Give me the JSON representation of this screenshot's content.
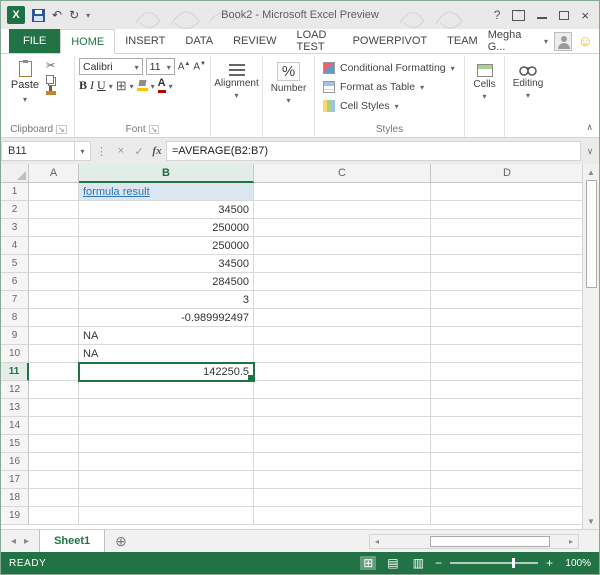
{
  "titlebar": {
    "title": "Book2 - Microsoft Excel Preview"
  },
  "tabs_row": {
    "tabs": [
      {
        "id": "file",
        "label": "FILE"
      },
      {
        "id": "home",
        "label": "HOME"
      },
      {
        "id": "insert",
        "label": "INSERT"
      },
      {
        "id": "data",
        "label": "DATA"
      },
      {
        "id": "review",
        "label": "REVIEW"
      },
      {
        "id": "load-test",
        "label": "LOAD TEST"
      },
      {
        "id": "powerpivot",
        "label": "POWERPIVOT"
      },
      {
        "id": "team",
        "label": "TEAM"
      }
    ],
    "active_tab": "HOME",
    "user_name": "Megha G..."
  },
  "ribbon": {
    "paste_label": "Paste",
    "font_name": "Calibri",
    "font_size": "11",
    "bold": "B",
    "italic": "I",
    "underline": "U",
    "percent": "%",
    "alignment_label": "Alignment",
    "number_label": "Number",
    "styles_buttons": [
      "Conditional Formatting",
      "Format as Table",
      "Cell Styles"
    ],
    "cells_label": "Cells",
    "editing_label": "Editing",
    "group_labels": {
      "clipboard": "Clipboard",
      "font": "Font",
      "styles": "Styles"
    }
  },
  "formula_bar": {
    "name_box": "B11",
    "fx_label": "fx",
    "formula": "=AVERAGE(B2:B7)"
  },
  "grid": {
    "columns": [
      "A",
      "B",
      "C",
      "D"
    ],
    "row_count": 19,
    "selected_cell": "B11",
    "selected_column": "B",
    "selected_row": 11,
    "cells": {
      "B1": {
        "text": "formula result",
        "align": "left",
        "style": "link"
      },
      "B2": {
        "text": "34500",
        "align": "right"
      },
      "B3": {
        "text": "250000",
        "align": "right"
      },
      "B4": {
        "text": "250000",
        "align": "right"
      },
      "B5": {
        "text": "34500",
        "align": "right"
      },
      "B6": {
        "text": "284500",
        "align": "right"
      },
      "B7": {
        "text": "3",
        "align": "right"
      },
      "B8": {
        "text": "-0.989992497",
        "align": "right"
      },
      "B9": {
        "text": "NA",
        "align": "left"
      },
      "B10": {
        "text": "NA",
        "align": "left"
      },
      "B11": {
        "text": "142250.5",
        "align": "right"
      }
    }
  },
  "sheet_bar": {
    "tabs": [
      "Sheet1"
    ],
    "active": "Sheet1"
  },
  "status_bar": {
    "status": "READY",
    "zoom": "100%"
  },
  "colors": {
    "excel_green": "#217346",
    "selection_green": "#217346",
    "link_blue": "#2E75B6",
    "link_fill": "#DCE6F1"
  }
}
